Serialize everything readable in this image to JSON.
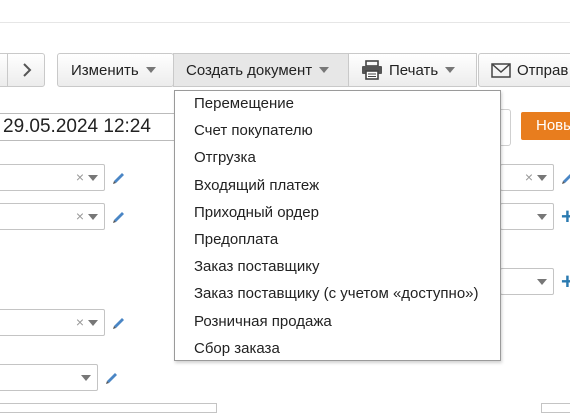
{
  "toolbar": {
    "change_label": "Изменить",
    "create_doc_label": "Создать документ",
    "print_label": "Печать",
    "send_label": "Отправ"
  },
  "document": {
    "date_value": "29.05.2024 12:24",
    "new_button_label": "Новы"
  },
  "create_menu": {
    "items": [
      "Перемещение",
      "Счет покупателю",
      "Отгрузка",
      "Входящий платеж",
      "Приходный ордер",
      "Предоплата",
      "Заказ поставщику",
      "Заказ поставщику (с учетом «доступно»)",
      "Розничная продажа",
      "Сбор заказа"
    ]
  },
  "icons": {
    "clear": "×",
    "plus": "+",
    "nav_next": "chevron-right-icon",
    "print": "printer-icon",
    "send": "envelope-icon",
    "edit": "pencil-icon"
  },
  "colors": {
    "accent_orange": "#e87d1e",
    "link_blue": "#2a7ab0"
  }
}
